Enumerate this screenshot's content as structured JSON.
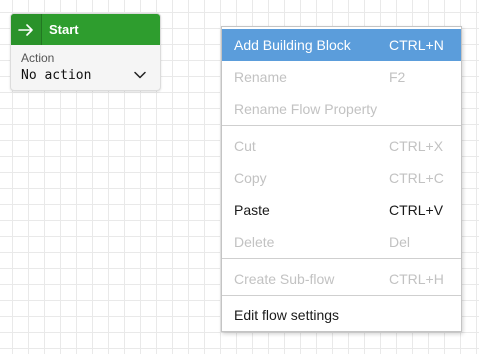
{
  "node": {
    "title": "Start",
    "field_label": "Action",
    "field_value": "No action",
    "header_color": "#2e9d2e",
    "icon": "arrow-right-icon"
  },
  "menu": {
    "highlight_color": "#5b9ddb",
    "items": [
      {
        "label": "Add Building Block",
        "shortcut": "CTRL+N"
      },
      {
        "label": "Rename",
        "shortcut": "F2"
      },
      {
        "label": "Rename Flow Property",
        "shortcut": ""
      },
      {
        "label": "Cut",
        "shortcut": "CTRL+X"
      },
      {
        "label": "Copy",
        "shortcut": "CTRL+C"
      },
      {
        "label": "Paste",
        "shortcut": "CTRL+V"
      },
      {
        "label": "Delete",
        "shortcut": "Del"
      },
      {
        "label": "Create Sub-flow",
        "shortcut": "CTRL+H"
      },
      {
        "label": "Edit flow settings",
        "shortcut": ""
      }
    ]
  }
}
